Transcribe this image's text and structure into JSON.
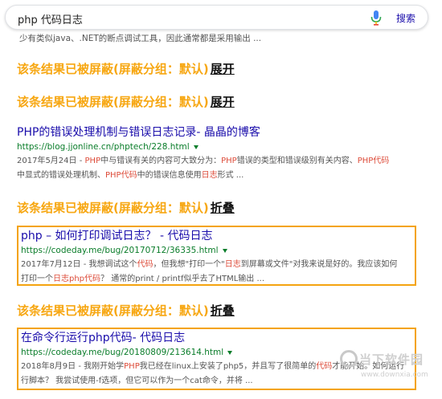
{
  "search": {
    "query": "php 代码日志",
    "button_label": "搜索",
    "mic_icon": "microphone-icon"
  },
  "top_snippet": "少有类似java、.NET的断点调试工具，因此通常都是采用输出 ...",
  "blocked_notice": {
    "text": "该条结果已被屏蔽(屏蔽分组：默认)",
    "expand_label": "展开",
    "collapse_label": "折叠"
  },
  "results": [
    {
      "title": "PHP的错误处理机制与错误日志记录- 晶晶的博客",
      "url": "https://blog.jjonline.cn/phptech/228.html",
      "line1": [
        {
          "t": "2017年5月24日 - ",
          "h": false
        },
        {
          "t": "PHP",
          "h": true
        },
        {
          "t": "中与错误有关的内容可大致分为：",
          "h": false
        },
        {
          "t": "PHP",
          "h": true
        },
        {
          "t": "错误的类型和错误级别有关内容、",
          "h": false
        },
        {
          "t": "PHP代码",
          "h": true
        }
      ],
      "line2": [
        {
          "t": "中显式的错误处理机制、",
          "h": false
        },
        {
          "t": "PHP代码",
          "h": true
        },
        {
          "t": "中的错误信息使用",
          "h": false
        },
        {
          "t": "日志",
          "h": true
        },
        {
          "t": "形式 ...",
          "h": false
        }
      ]
    },
    {
      "title": "php – 如何打印调试日志？ - 代码日志",
      "url": "https://codeday.me/bug/20170712/36335.html",
      "line1": [
        {
          "t": "2017年7月12日 - 我想调试这个",
          "h": false
        },
        {
          "t": "代码",
          "h": true
        },
        {
          "t": "，但我想\"打印一个\"",
          "h": false
        },
        {
          "t": "日志",
          "h": true
        },
        {
          "t": "到屏幕或文件\"对我来说是好的。我应该如何",
          "h": false
        }
      ],
      "line2": [
        {
          "t": "打印一个",
          "h": false
        },
        {
          "t": "日志php代码",
          "h": true
        },
        {
          "t": "？ 通常的print / printf似乎去了HTML输出 ...",
          "h": false
        }
      ]
    },
    {
      "title": "在命令行运行php代码- 代码日志",
      "url": "https://codeday.me/bug/20180809/213614.html",
      "line1": [
        {
          "t": "2018年8月9日 - 我刚开始学",
          "h": false
        },
        {
          "t": "PHP",
          "h": true
        },
        {
          "t": "我已经在linux上安装了php5，并且写了很简单的",
          "h": false
        },
        {
          "t": "代码",
          "h": true
        },
        {
          "t": "才能开始。如何运行",
          "h": false
        }
      ],
      "line2": [
        {
          "t": "行脚本？ 我尝试使用-f选项，但它可以作为一个cat命令，并将 ...",
          "h": false
        }
      ]
    }
  ],
  "watermark": {
    "brand": "当下软件园",
    "url": "www.downxia.com"
  },
  "colors": {
    "blocked_orange": "#f7a712",
    "box_border": "#f4a30f",
    "link_blue": "#1a0dab",
    "url_green": "#0a7d2a",
    "highlight_red": "#dd4b39"
  }
}
